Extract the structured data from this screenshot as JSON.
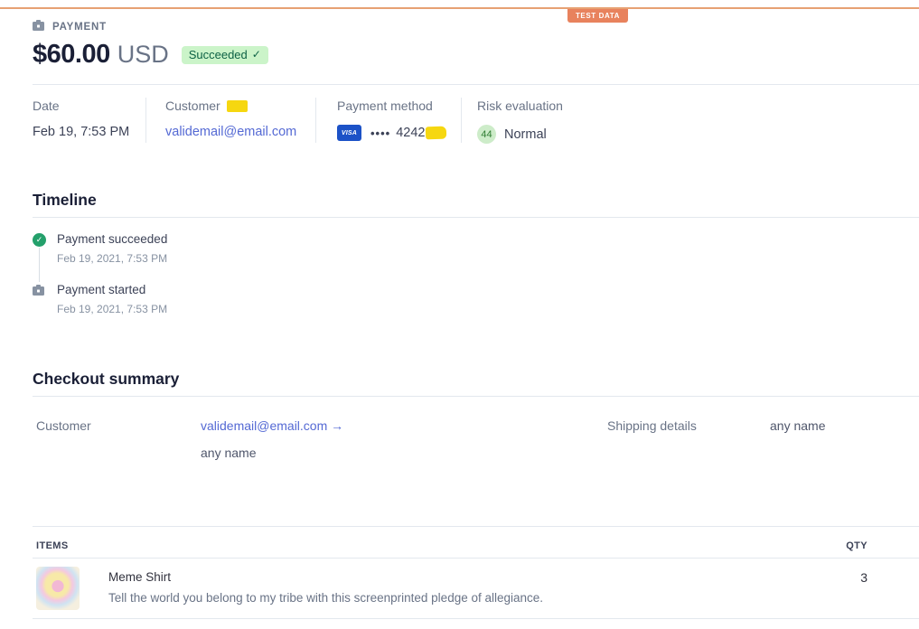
{
  "banner": {
    "test_badge": "TEST DATA"
  },
  "header": {
    "eyebrow": "PAYMENT",
    "amount": "$60.00",
    "currency": "USD",
    "status": "Succeeded",
    "status_check": "✓"
  },
  "meta": {
    "date": {
      "label": "Date",
      "value": "Feb 19, 7:53 PM"
    },
    "customer": {
      "label": "Customer",
      "value": "validemail@email.com"
    },
    "payment_method": {
      "label": "Payment method",
      "brand": "VISA",
      "dots": "••••",
      "last4": "4242"
    },
    "risk": {
      "label": "Risk evaluation",
      "score": "44",
      "value": "Normal"
    }
  },
  "timeline": {
    "title": "Timeline",
    "events": [
      {
        "title": "Payment succeeded",
        "timestamp": "Feb 19, 2021, 7:53 PM",
        "icon": "check-circle"
      },
      {
        "title": "Payment started",
        "timestamp": "Feb 19, 2021, 7:53 PM",
        "icon": "payment"
      }
    ]
  },
  "checkout": {
    "title": "Checkout summary",
    "customer_label": "Customer",
    "customer_email": "validemail@email.com",
    "customer_arrow": "→",
    "customer_name": "any name",
    "shipping_label": "Shipping details",
    "shipping_value": "any name"
  },
  "items_table": {
    "items_header": "ITEMS",
    "qty_header": "QTY",
    "rows": [
      {
        "name": "Meme Shirt",
        "description": "Tell the world you belong to my tribe with this screenprinted pledge of allegiance.",
        "qty": "3"
      }
    ]
  },
  "colors": {
    "test_orange": "#e8825d",
    "test_line": "#e7a173",
    "success_badge_bg": "#cbf4c9",
    "success_badge_text": "#0e6245",
    "link_blurple": "#5469d4",
    "visa_blue": "#1c52c7",
    "highlight_yellow": "#f6d710",
    "timeline_green": "#24a06b",
    "divider": "#e3e8ee",
    "heading_dark": "#1a1f36",
    "label_gray": "#697386"
  }
}
